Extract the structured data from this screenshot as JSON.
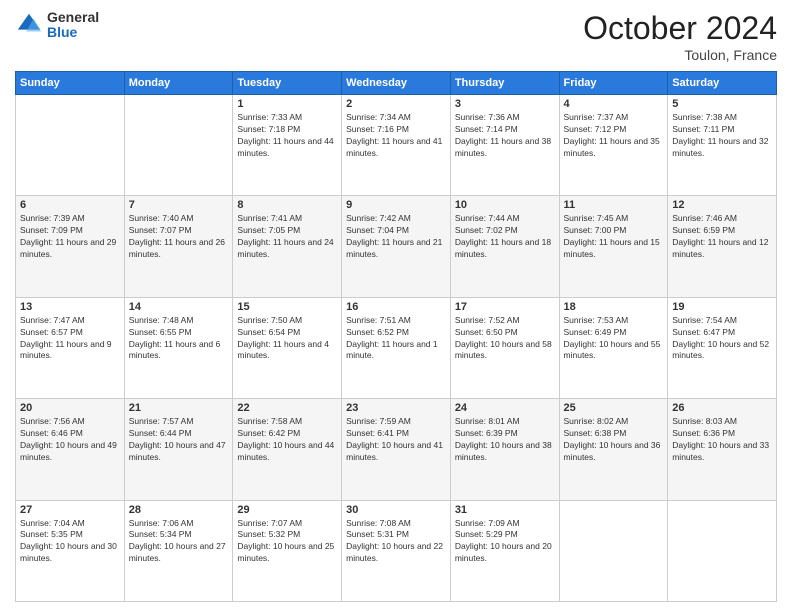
{
  "header": {
    "logo_general": "General",
    "logo_blue": "Blue",
    "month_title": "October 2024",
    "location": "Toulon, France"
  },
  "weekdays": [
    "Sunday",
    "Monday",
    "Tuesday",
    "Wednesday",
    "Thursday",
    "Friday",
    "Saturday"
  ],
  "weeks": [
    [
      {
        "day": "",
        "sunrise": "",
        "sunset": "",
        "daylight": ""
      },
      {
        "day": "",
        "sunrise": "",
        "sunset": "",
        "daylight": ""
      },
      {
        "day": "1",
        "sunrise": "Sunrise: 7:33 AM",
        "sunset": "Sunset: 7:18 PM",
        "daylight": "Daylight: 11 hours and 44 minutes."
      },
      {
        "day": "2",
        "sunrise": "Sunrise: 7:34 AM",
        "sunset": "Sunset: 7:16 PM",
        "daylight": "Daylight: 11 hours and 41 minutes."
      },
      {
        "day": "3",
        "sunrise": "Sunrise: 7:36 AM",
        "sunset": "Sunset: 7:14 PM",
        "daylight": "Daylight: 11 hours and 38 minutes."
      },
      {
        "day": "4",
        "sunrise": "Sunrise: 7:37 AM",
        "sunset": "Sunset: 7:12 PM",
        "daylight": "Daylight: 11 hours and 35 minutes."
      },
      {
        "day": "5",
        "sunrise": "Sunrise: 7:38 AM",
        "sunset": "Sunset: 7:11 PM",
        "daylight": "Daylight: 11 hours and 32 minutes."
      }
    ],
    [
      {
        "day": "6",
        "sunrise": "Sunrise: 7:39 AM",
        "sunset": "Sunset: 7:09 PM",
        "daylight": "Daylight: 11 hours and 29 minutes."
      },
      {
        "day": "7",
        "sunrise": "Sunrise: 7:40 AM",
        "sunset": "Sunset: 7:07 PM",
        "daylight": "Daylight: 11 hours and 26 minutes."
      },
      {
        "day": "8",
        "sunrise": "Sunrise: 7:41 AM",
        "sunset": "Sunset: 7:05 PM",
        "daylight": "Daylight: 11 hours and 24 minutes."
      },
      {
        "day": "9",
        "sunrise": "Sunrise: 7:42 AM",
        "sunset": "Sunset: 7:04 PM",
        "daylight": "Daylight: 11 hours and 21 minutes."
      },
      {
        "day": "10",
        "sunrise": "Sunrise: 7:44 AM",
        "sunset": "Sunset: 7:02 PM",
        "daylight": "Daylight: 11 hours and 18 minutes."
      },
      {
        "day": "11",
        "sunrise": "Sunrise: 7:45 AM",
        "sunset": "Sunset: 7:00 PM",
        "daylight": "Daylight: 11 hours and 15 minutes."
      },
      {
        "day": "12",
        "sunrise": "Sunrise: 7:46 AM",
        "sunset": "Sunset: 6:59 PM",
        "daylight": "Daylight: 11 hours and 12 minutes."
      }
    ],
    [
      {
        "day": "13",
        "sunrise": "Sunrise: 7:47 AM",
        "sunset": "Sunset: 6:57 PM",
        "daylight": "Daylight: 11 hours and 9 minutes."
      },
      {
        "day": "14",
        "sunrise": "Sunrise: 7:48 AM",
        "sunset": "Sunset: 6:55 PM",
        "daylight": "Daylight: 11 hours and 6 minutes."
      },
      {
        "day": "15",
        "sunrise": "Sunrise: 7:50 AM",
        "sunset": "Sunset: 6:54 PM",
        "daylight": "Daylight: 11 hours and 4 minutes."
      },
      {
        "day": "16",
        "sunrise": "Sunrise: 7:51 AM",
        "sunset": "Sunset: 6:52 PM",
        "daylight": "Daylight: 11 hours and 1 minute."
      },
      {
        "day": "17",
        "sunrise": "Sunrise: 7:52 AM",
        "sunset": "Sunset: 6:50 PM",
        "daylight": "Daylight: 10 hours and 58 minutes."
      },
      {
        "day": "18",
        "sunrise": "Sunrise: 7:53 AM",
        "sunset": "Sunset: 6:49 PM",
        "daylight": "Daylight: 10 hours and 55 minutes."
      },
      {
        "day": "19",
        "sunrise": "Sunrise: 7:54 AM",
        "sunset": "Sunset: 6:47 PM",
        "daylight": "Daylight: 10 hours and 52 minutes."
      }
    ],
    [
      {
        "day": "20",
        "sunrise": "Sunrise: 7:56 AM",
        "sunset": "Sunset: 6:46 PM",
        "daylight": "Daylight: 10 hours and 49 minutes."
      },
      {
        "day": "21",
        "sunrise": "Sunrise: 7:57 AM",
        "sunset": "Sunset: 6:44 PM",
        "daylight": "Daylight: 10 hours and 47 minutes."
      },
      {
        "day": "22",
        "sunrise": "Sunrise: 7:58 AM",
        "sunset": "Sunset: 6:42 PM",
        "daylight": "Daylight: 10 hours and 44 minutes."
      },
      {
        "day": "23",
        "sunrise": "Sunrise: 7:59 AM",
        "sunset": "Sunset: 6:41 PM",
        "daylight": "Daylight: 10 hours and 41 minutes."
      },
      {
        "day": "24",
        "sunrise": "Sunrise: 8:01 AM",
        "sunset": "Sunset: 6:39 PM",
        "daylight": "Daylight: 10 hours and 38 minutes."
      },
      {
        "day": "25",
        "sunrise": "Sunrise: 8:02 AM",
        "sunset": "Sunset: 6:38 PM",
        "daylight": "Daylight: 10 hours and 36 minutes."
      },
      {
        "day": "26",
        "sunrise": "Sunrise: 8:03 AM",
        "sunset": "Sunset: 6:36 PM",
        "daylight": "Daylight: 10 hours and 33 minutes."
      }
    ],
    [
      {
        "day": "27",
        "sunrise": "Sunrise: 7:04 AM",
        "sunset": "Sunset: 5:35 PM",
        "daylight": "Daylight: 10 hours and 30 minutes."
      },
      {
        "day": "28",
        "sunrise": "Sunrise: 7:06 AM",
        "sunset": "Sunset: 5:34 PM",
        "daylight": "Daylight: 10 hours and 27 minutes."
      },
      {
        "day": "29",
        "sunrise": "Sunrise: 7:07 AM",
        "sunset": "Sunset: 5:32 PM",
        "daylight": "Daylight: 10 hours and 25 minutes."
      },
      {
        "day": "30",
        "sunrise": "Sunrise: 7:08 AM",
        "sunset": "Sunset: 5:31 PM",
        "daylight": "Daylight: 10 hours and 22 minutes."
      },
      {
        "day": "31",
        "sunrise": "Sunrise: 7:09 AM",
        "sunset": "Sunset: 5:29 PM",
        "daylight": "Daylight: 10 hours and 20 minutes."
      },
      {
        "day": "",
        "sunrise": "",
        "sunset": "",
        "daylight": ""
      },
      {
        "day": "",
        "sunrise": "",
        "sunset": "",
        "daylight": ""
      }
    ]
  ]
}
